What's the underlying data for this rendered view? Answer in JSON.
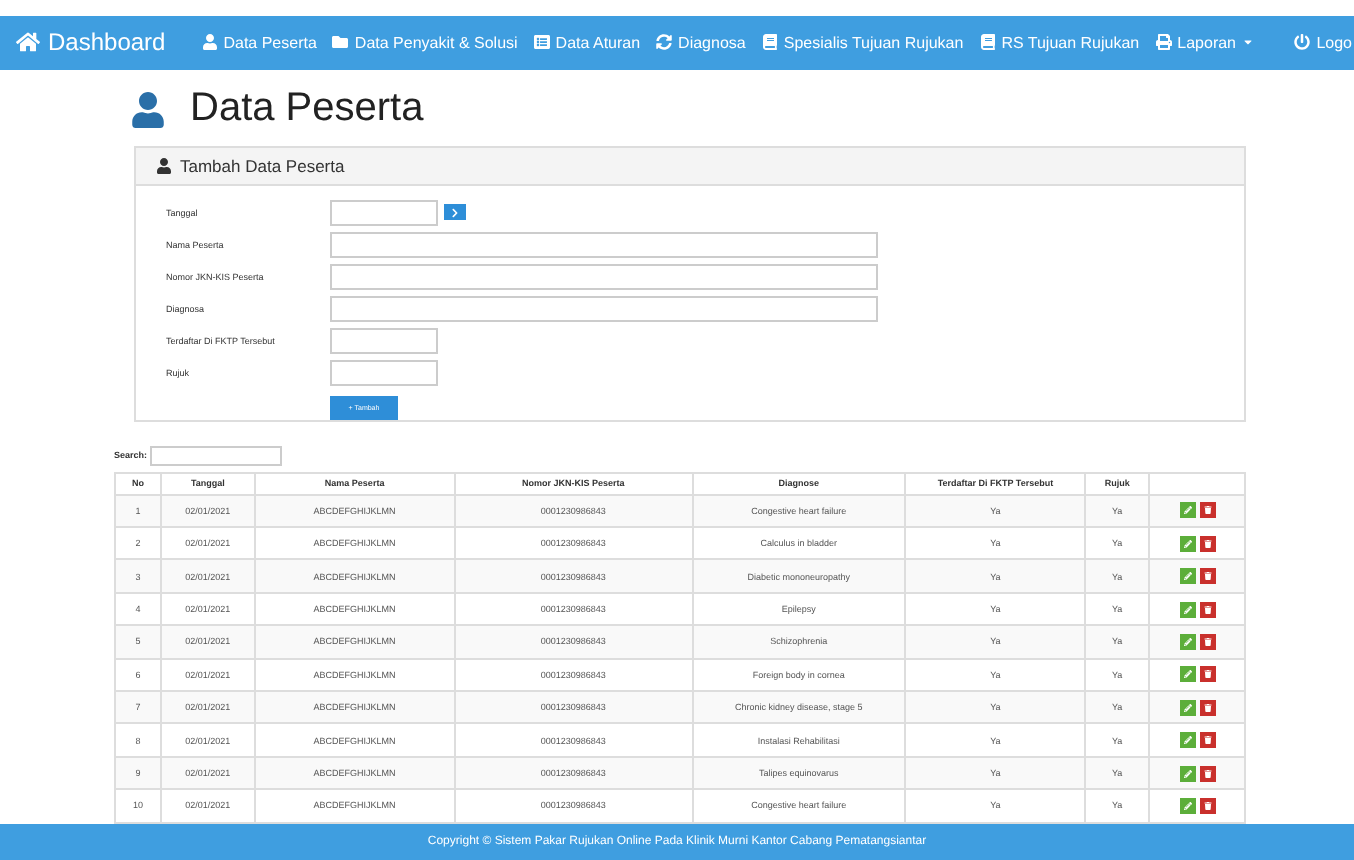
{
  "navbar": {
    "brand": "Dashboard",
    "items": [
      {
        "label": "Data Peserta",
        "kind": "user"
      },
      {
        "label": "Data Penyakit & Solusi",
        "kind": "folder"
      },
      {
        "label": "Data Aturan",
        "kind": "list"
      },
      {
        "label": "Diagnosa",
        "kind": "refresh"
      },
      {
        "label": "Spesialis Tujuan Rujukan",
        "kind": "book"
      },
      {
        "label": "RS Tujuan Rujukan",
        "kind": "book"
      },
      {
        "label": "Laporan",
        "kind": "print",
        "dropdown": true
      }
    ],
    "logout": "Logo"
  },
  "page_title": "Data Peserta",
  "panel": {
    "title": "Tambah Data Peserta",
    "fields": [
      {
        "label": "Tanggal",
        "kind": "date"
      },
      {
        "label": "Nama Peserta",
        "kind": "wide"
      },
      {
        "label": "Nomor JKN-KIS Peserta",
        "kind": "wide"
      },
      {
        "label": "Diagnosa",
        "kind": "wide"
      },
      {
        "label": "Terdaftar Di FKTP Tersebut",
        "kind": "short"
      },
      {
        "label": "Rujuk",
        "kind": "short"
      }
    ],
    "submit": "+ Tambah"
  },
  "search": {
    "label": "Search:"
  },
  "table": {
    "columns": [
      "No",
      "Tanggal",
      "Nama Peserta",
      "Nomor JKN-KIS Peserta",
      "Diagnose",
      "Terdaftar Di FKTP Tersebut",
      "Rujuk"
    ],
    "rows": [
      [
        "1",
        "02/01/2021",
        "ABCDEFGHIJKLMN",
        "0001230986843",
        "Congestive heart failure",
        "Ya",
        "Ya"
      ],
      [
        "2",
        "02/01/2021",
        "ABCDEFGHIJKLMN",
        "0001230986843",
        "Calculus in bladder",
        "Ya",
        "Ya"
      ],
      [
        "3",
        "02/01/2021",
        "ABCDEFGHIJKLMN",
        "0001230986843",
        "Diabetic mononeuropathy",
        "Ya",
        "Ya"
      ],
      [
        "4",
        "02/01/2021",
        "ABCDEFGHIJKLMN",
        "0001230986843",
        "Epilepsy",
        "Ya",
        "Ya"
      ],
      [
        "5",
        "02/01/2021",
        "ABCDEFGHIJKLMN",
        "0001230986843",
        "Schizophrenia",
        "Ya",
        "Ya"
      ],
      [
        "6",
        "02/01/2021",
        "ABCDEFGHIJKLMN",
        "0001230986843",
        "Foreign body in cornea",
        "Ya",
        "Ya"
      ],
      [
        "7",
        "02/01/2021",
        "ABCDEFGHIJKLMN",
        "0001230986843",
        "Chronic kidney disease, stage 5",
        "Ya",
        "Ya"
      ],
      [
        "8",
        "02/01/2021",
        "ABCDEFGHIJKLMN",
        "0001230986843",
        "Instalasi Rehabilitasi",
        "Ya",
        "Ya"
      ],
      [
        "9",
        "02/01/2021",
        "ABCDEFGHIJKLMN",
        "0001230986843",
        "Talipes equinovarus",
        "Ya",
        "Ya"
      ],
      [
        "10",
        "02/01/2021",
        "ABCDEFGHIJKLMN",
        "0001230986843",
        "Congestive heart failure",
        "Ya",
        "Ya"
      ]
    ]
  },
  "footer": "Copyright © Sistem Pakar Rujukan Online Pada Klinik Murni Kantor Cabang Pematangsiantar"
}
